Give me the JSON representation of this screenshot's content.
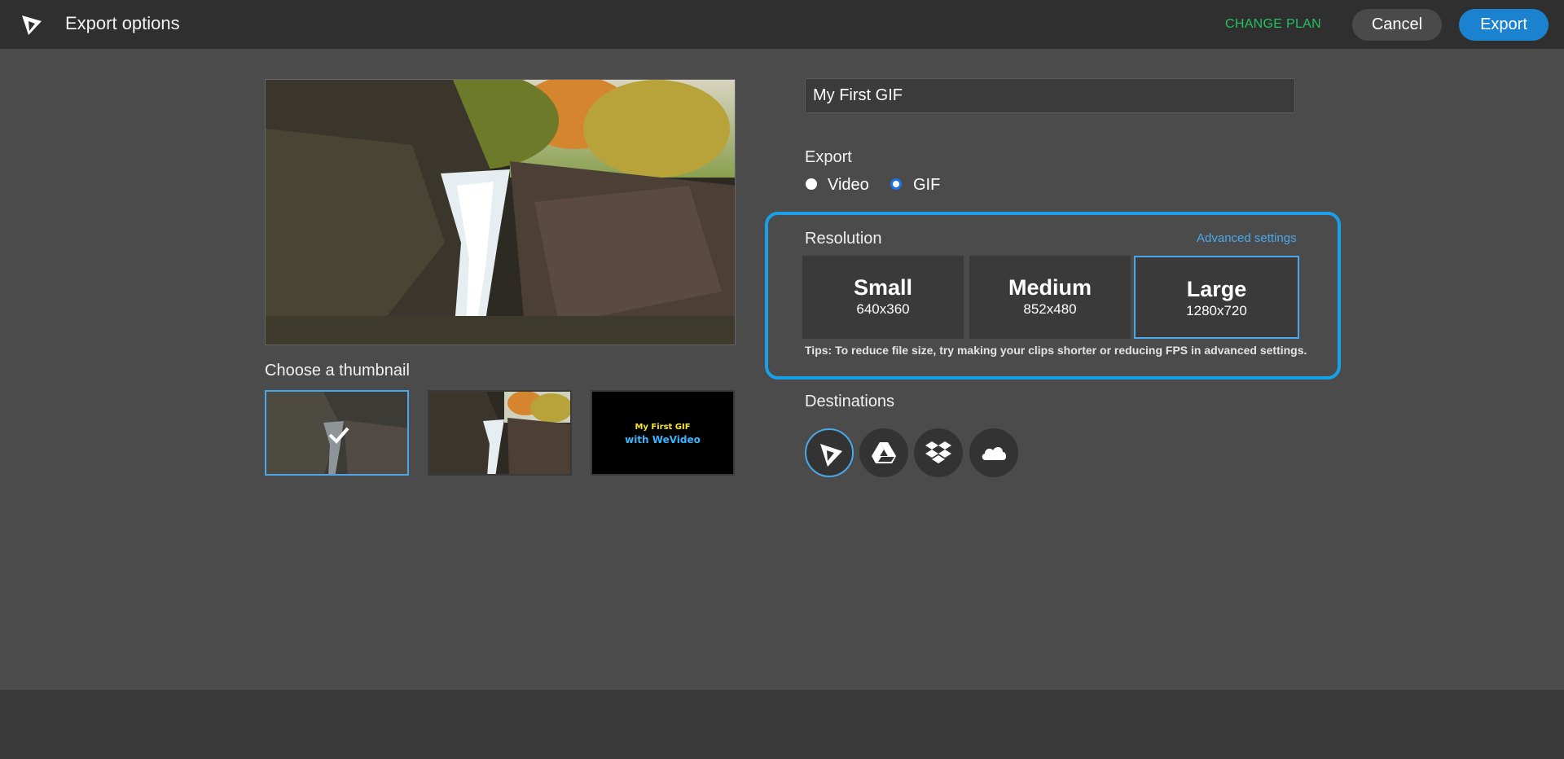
{
  "header": {
    "title": "Export options",
    "change_plan": "CHANGE PLAN",
    "cancel": "Cancel",
    "export": "Export"
  },
  "thumbnails": {
    "label": "Choose a thumbnail",
    "text_thumb": {
      "line1": "My First GIF",
      "line2": "with WeVideo"
    }
  },
  "form": {
    "name_value": "My First GIF",
    "export_label": "Export",
    "options": [
      "Video",
      "GIF"
    ],
    "selected_option": "GIF"
  },
  "resolution": {
    "label": "Resolution",
    "advanced": "Advanced settings",
    "cards": [
      {
        "name": "Small",
        "size": "640x360"
      },
      {
        "name": "Medium",
        "size": "852x480"
      },
      {
        "name": "Large",
        "size": "1280x720"
      }
    ],
    "selected": "Large",
    "tips": "Tips: To reduce file size, try making your clips shorter or reducing FPS in advanced settings."
  },
  "destinations": {
    "label": "Destinations",
    "items": [
      "wevideo-icon",
      "google-drive-icon",
      "dropbox-icon",
      "onedrive-icon"
    ],
    "selected": "wevideo-icon"
  },
  "colors": {
    "accent": "#1aa0e8",
    "export_button": "#1a82cf",
    "change_plan": "#22c35e"
  }
}
